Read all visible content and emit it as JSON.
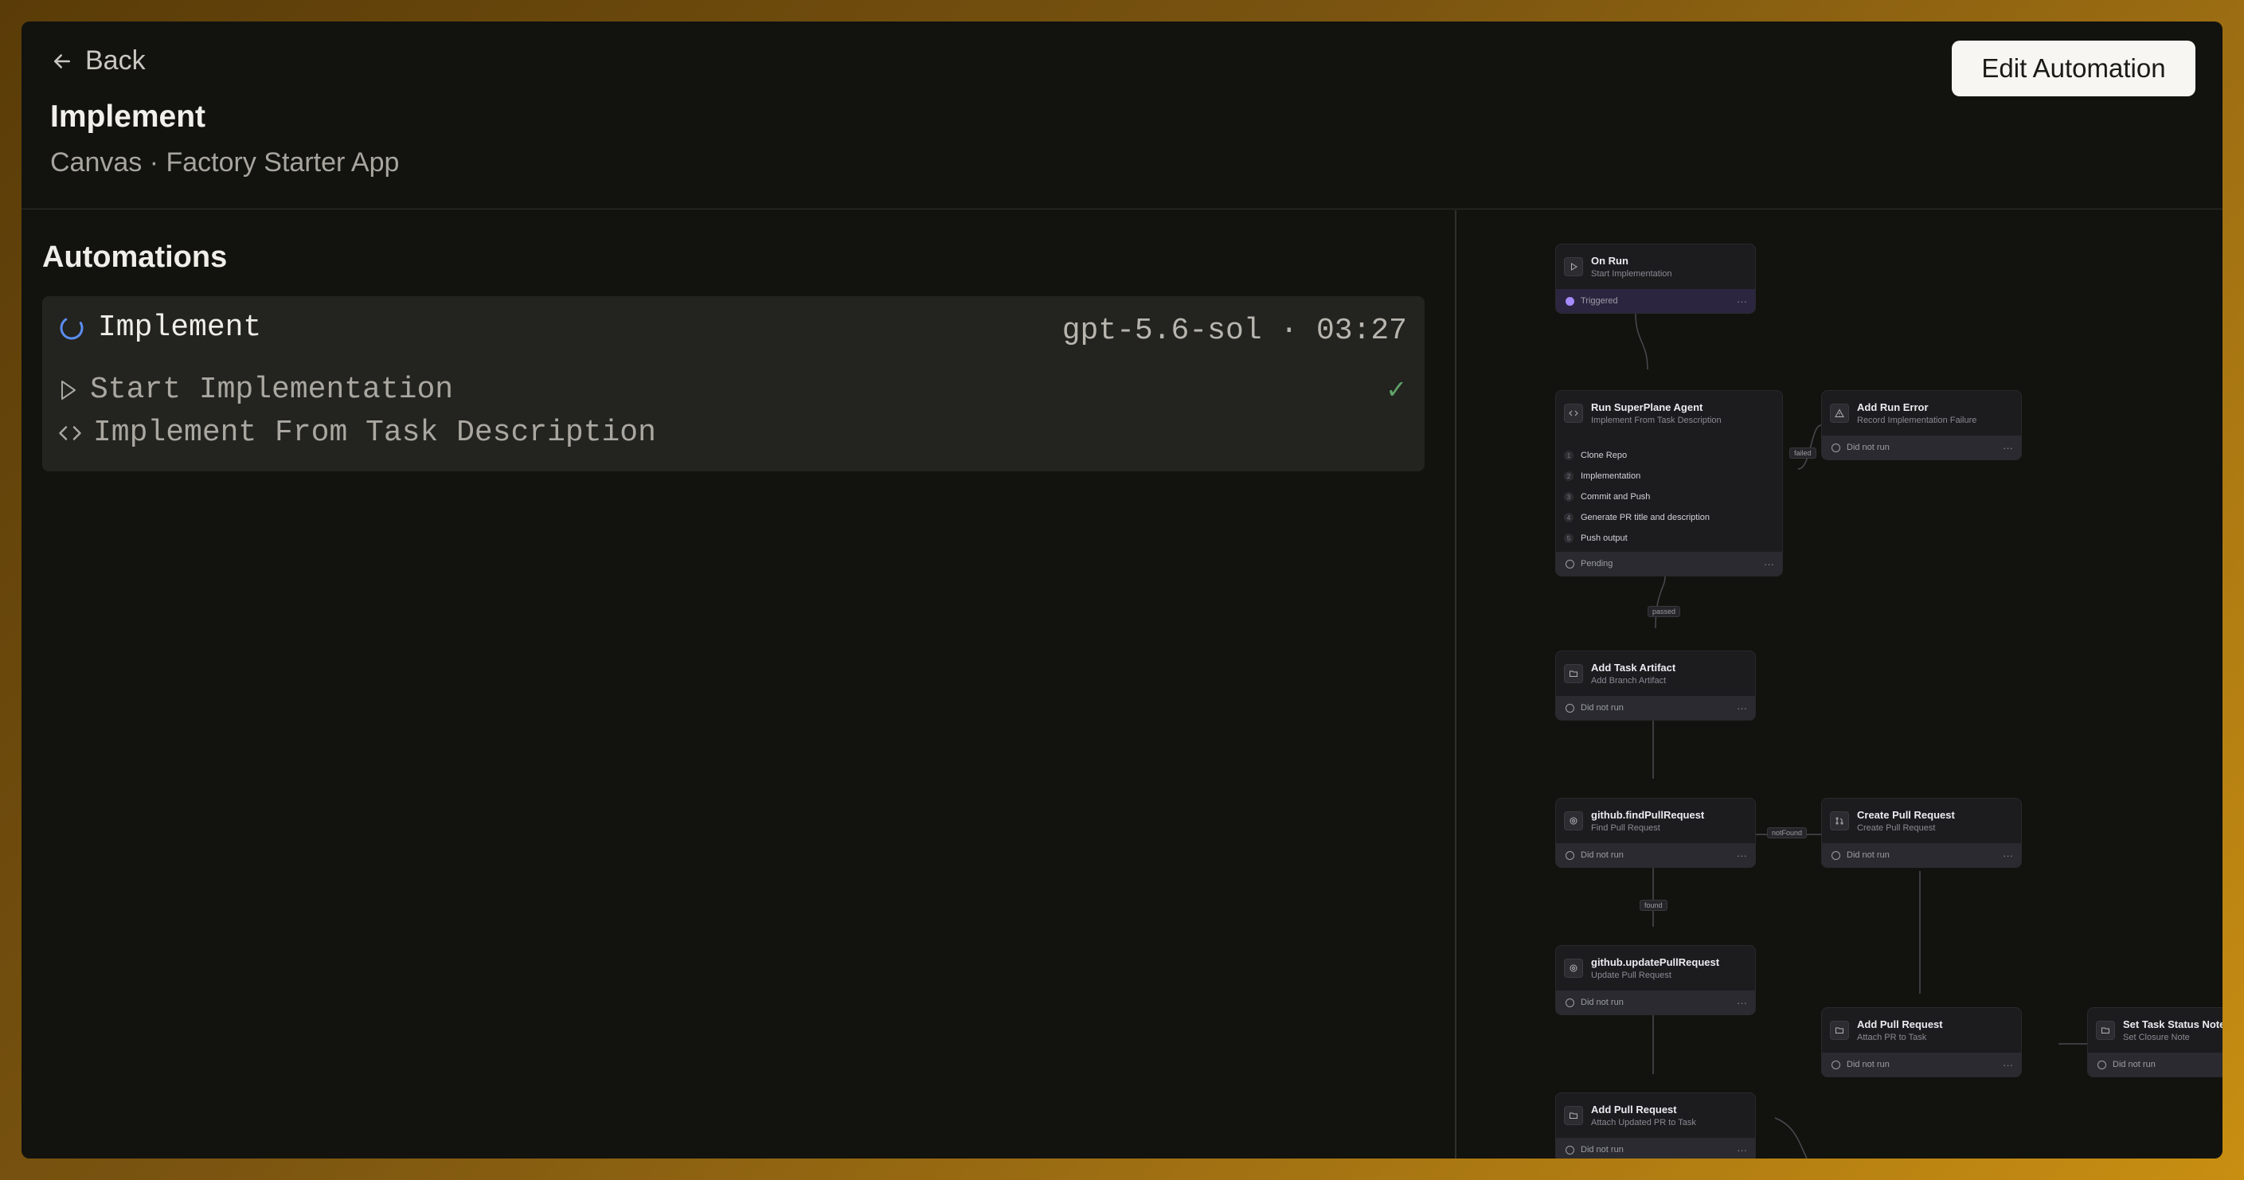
{
  "header": {
    "back_label": "Back",
    "title": "Implement",
    "subtitle": "Canvas · Factory Starter App",
    "edit_button": "Edit Automation"
  },
  "automations": {
    "section_title": "Automations",
    "run": {
      "name": "Implement",
      "meta": "gpt-5.6-sol · 03:27",
      "steps": [
        {
          "label": "Start Implementation",
          "icon": "play-icon",
          "done": "✓"
        },
        {
          "label": "Implement From Task Description",
          "icon": "code-icon"
        }
      ]
    }
  },
  "canvas": {
    "nodes": [
      {
        "title": "On Run",
        "subtitle": "Start Implementation",
        "status": "Triggered",
        "more": "···"
      },
      {
        "title": "Run SuperPlane Agent",
        "subtitle": "Implement From Task Description",
        "status": "Pending",
        "more": "···",
        "items": [
          "Clone Repo",
          "Implementation",
          "Commit and Push",
          "Generate PR title and description",
          "Push output"
        ],
        "item_numbers": [
          "1",
          "2",
          "3",
          "4",
          "5"
        ]
      },
      {
        "title": "Add Run Error",
        "subtitle": "Record Implementation Failure",
        "status": "Did not run",
        "more": "···"
      },
      {
        "title": "Add Task Artifact",
        "subtitle": "Add Branch Artifact",
        "status": "Did not run",
        "more": "···"
      },
      {
        "title": "github.findPullRequest",
        "subtitle": "Find Pull Request",
        "status": "Did not run",
        "more": "···"
      },
      {
        "title": "Create Pull Request",
        "subtitle": "Create Pull Request",
        "status": "Did not run",
        "more": "···"
      },
      {
        "title": "github.updatePullRequest",
        "subtitle": "Update Pull Request",
        "status": "Did not run",
        "more": "···"
      },
      {
        "title": "Add Pull Request",
        "subtitle": "Attach PR to Task",
        "status": "Did not run",
        "more": "···"
      },
      {
        "title": "Set Task Status Note",
        "subtitle": "Set Closure Note",
        "status": "Did not run",
        "more": "···"
      },
      {
        "title": "Add Pull Request",
        "subtitle": "Attach Updated PR to Task",
        "status": "Did not run",
        "more": "···"
      }
    ],
    "edge_labels": {
      "failed": "failed",
      "passed": "passed",
      "notfound": "notFound",
      "found": "found"
    }
  },
  "colors": {
    "accent": "#5b8def",
    "triggered": "#a58bff",
    "check": "#5fa36a"
  }
}
